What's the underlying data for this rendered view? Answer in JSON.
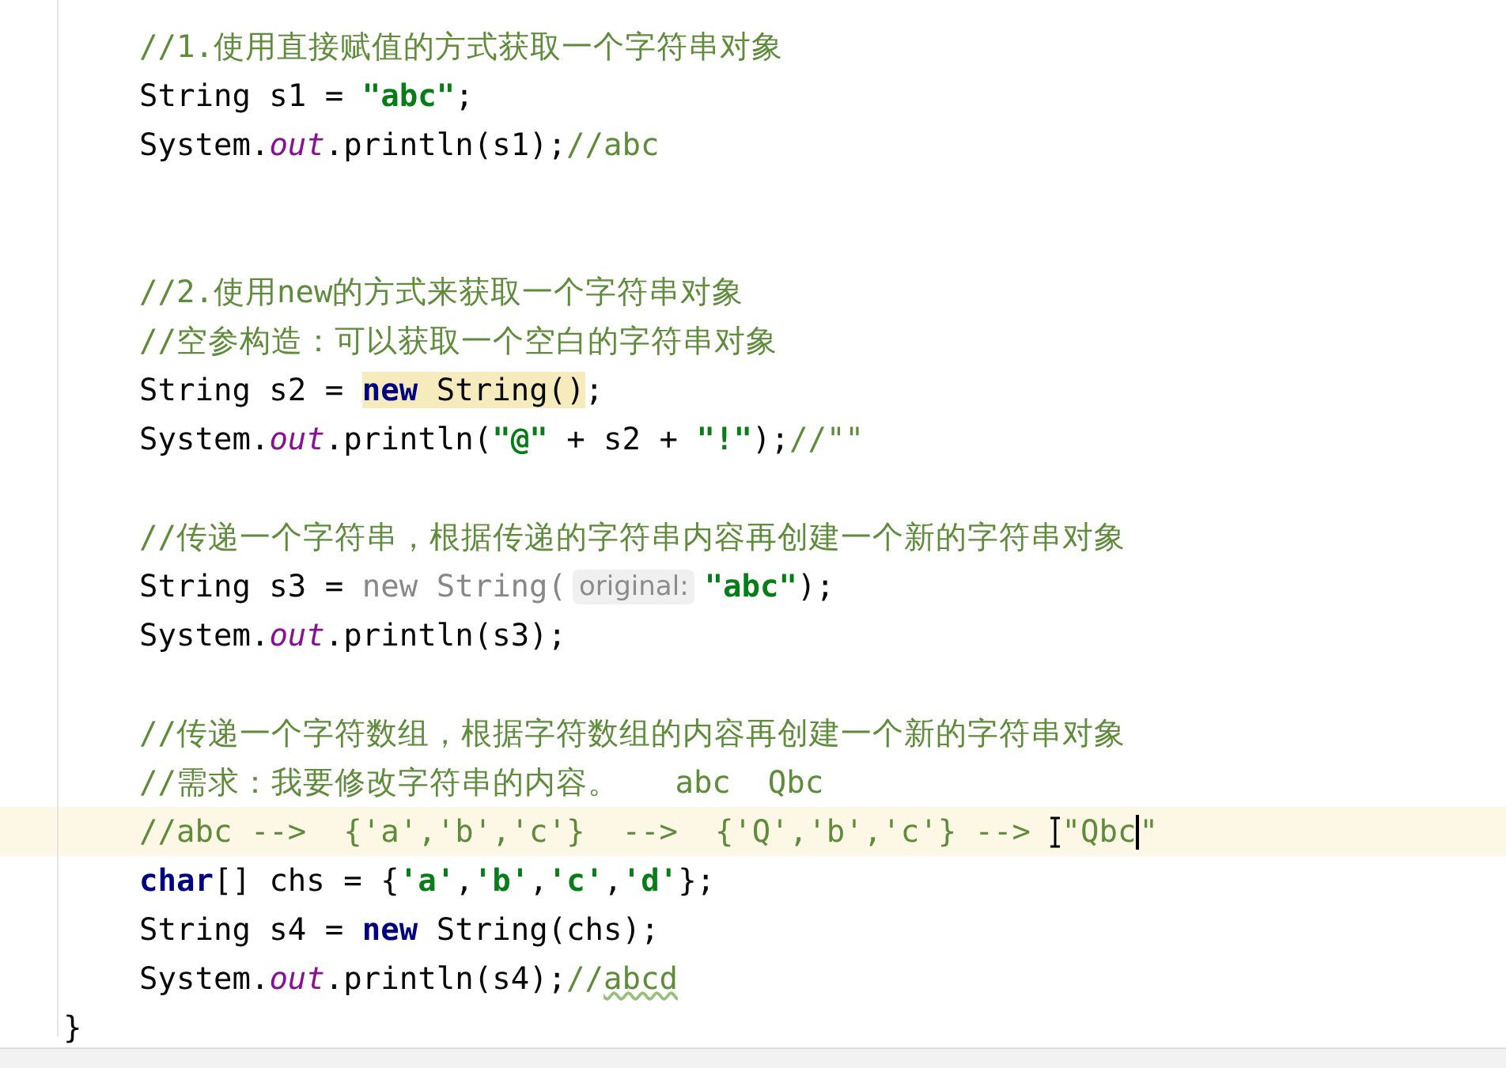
{
  "editor": {
    "lines": [
      {
        "current": false,
        "tokens": [
          {
            "kind": "comment",
            "text": "//1.使用直接赋值的方式获取一个字符串对象"
          }
        ]
      },
      {
        "current": false,
        "tokens": [
          {
            "kind": "plain",
            "text": "String s1 = "
          },
          {
            "kind": "string",
            "text": "\"abc\""
          },
          {
            "kind": "plain",
            "text": ";"
          }
        ]
      },
      {
        "current": false,
        "tokens": [
          {
            "kind": "plain",
            "text": "System."
          },
          {
            "kind": "field",
            "text": "out"
          },
          {
            "kind": "plain",
            "text": ".println(s1);"
          },
          {
            "kind": "comment",
            "text": "//abc"
          }
        ]
      },
      {
        "current": false
      },
      {
        "current": false
      },
      {
        "current": false,
        "tokens": [
          {
            "kind": "comment",
            "text": "//2.使用new的方式来获取一个字符串对象"
          }
        ]
      },
      {
        "current": false,
        "tokens": [
          {
            "kind": "comment",
            "text": "//空参构造：可以获取一个空白的字符串对象"
          }
        ]
      },
      {
        "current": false,
        "tokens": [
          {
            "kind": "plain",
            "text": "String s2 = "
          },
          {
            "kind": "keyword",
            "text": "new",
            "match": true
          },
          {
            "kind": "plain",
            "text": " String()",
            "match": true
          },
          {
            "kind": "plain",
            "text": ";"
          }
        ]
      },
      {
        "current": false,
        "tokens": [
          {
            "kind": "plain",
            "text": "System."
          },
          {
            "kind": "field",
            "text": "out"
          },
          {
            "kind": "plain",
            "text": ".println("
          },
          {
            "kind": "string",
            "text": "\"@\""
          },
          {
            "kind": "plain",
            "text": " + s2 + "
          },
          {
            "kind": "string",
            "text": "\"!\""
          },
          {
            "kind": "plain",
            "text": ");"
          },
          {
            "kind": "comment",
            "text": "//\"\""
          }
        ]
      },
      {
        "current": false
      },
      {
        "current": false,
        "tokens": [
          {
            "kind": "comment",
            "text": "//传递一个字符串，根据传递的字符串内容再创建一个新的字符串对象"
          }
        ]
      },
      {
        "current": false,
        "tokens": [
          {
            "kind": "plain",
            "text": "String s3 = "
          },
          {
            "kind": "dim",
            "text": "new String("
          },
          {
            "kind": "hint",
            "text": "original:"
          },
          {
            "kind": "string",
            "text": "\"abc\""
          },
          {
            "kind": "plain",
            "text": ");"
          }
        ]
      },
      {
        "current": false,
        "tokens": [
          {
            "kind": "plain",
            "text": "System."
          },
          {
            "kind": "field",
            "text": "out"
          },
          {
            "kind": "plain",
            "text": ".println(s3);"
          }
        ]
      },
      {
        "current": false
      },
      {
        "current": false,
        "tokens": [
          {
            "kind": "comment",
            "text": "//传递一个字符数组，根据字符数组的内容再创建一个新的字符串对象"
          }
        ]
      },
      {
        "current": false,
        "tokens": [
          {
            "kind": "comment",
            "text": "//需求：我要修改字符串的内容。   abc  Qbc"
          }
        ]
      },
      {
        "current": true,
        "tokens": [
          {
            "kind": "comment",
            "text": "//abc -->  {'a','b','c'}  -->  {'Q','b','c'} --> "
          },
          {
            "kind": "pointer"
          },
          {
            "kind": "comment",
            "text": "\"Qbc"
          },
          {
            "kind": "caret"
          },
          {
            "kind": "comment",
            "text": "\""
          }
        ]
      },
      {
        "current": false,
        "tokens": [
          {
            "kind": "keyword",
            "text": "char"
          },
          {
            "kind": "plain",
            "text": "[] chs = {"
          },
          {
            "kind": "string",
            "text": "'a'"
          },
          {
            "kind": "plain",
            "text": ","
          },
          {
            "kind": "string",
            "text": "'b'"
          },
          {
            "kind": "plain",
            "text": ","
          },
          {
            "kind": "string",
            "text": "'c'"
          },
          {
            "kind": "plain",
            "text": ","
          },
          {
            "kind": "string",
            "text": "'d'"
          },
          {
            "kind": "plain",
            "text": "};"
          }
        ]
      },
      {
        "current": false,
        "tokens": [
          {
            "kind": "plain",
            "text": "String s4 = "
          },
          {
            "kind": "keyword",
            "text": "new"
          },
          {
            "kind": "plain",
            "text": " String(chs);"
          }
        ]
      },
      {
        "current": false,
        "tokens": [
          {
            "kind": "plain",
            "text": "System."
          },
          {
            "kind": "field",
            "text": "out"
          },
          {
            "kind": "plain",
            "text": ".println(s4);"
          },
          {
            "kind": "comment",
            "text": "//"
          },
          {
            "kind": "typo",
            "text": "abcd"
          }
        ]
      }
    ],
    "closing_brace": "}"
  }
}
